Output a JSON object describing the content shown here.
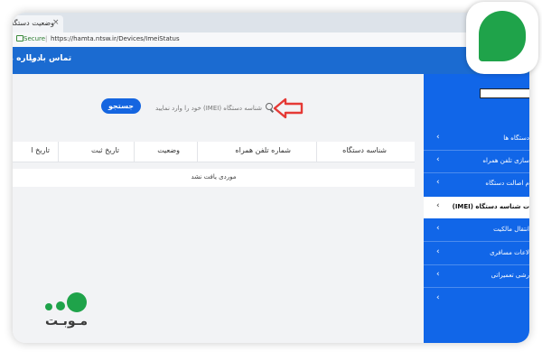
{
  "browser": {
    "tab_title": "وضعیت دستگاه",
    "tab_close": "×",
    "secure_label": "Secure",
    "separator": "|",
    "url": "https://hamta.ntsw.ir/Devices/ImeiStatus"
  },
  "navbar": {
    "contact": "تماس با ما",
    "about": "درباره ما"
  },
  "search": {
    "placeholder": "شناسه دستگاه (IMEI) خود را وارد نمایید",
    "button_label": "جستجو"
  },
  "table": {
    "columns": [
      "شناسه دستگاه",
      "شماره تلفن همراه",
      "وضعیت",
      "تاریخ ثبت",
      "تاریخ ا"
    ],
    "empty_message": "موردی یافت نشد"
  },
  "sidebar": {
    "items": [
      {
        "label": "دستگاه ها",
        "chevron": "›"
      },
      {
        "label": "سازی تلفن همراه",
        "chevron": "›"
      },
      {
        "label": "م اصالت دستگاه",
        "chevron": "›"
      },
      {
        "label": "ت شناسه دستگاه (IMEI)",
        "chevron": "›"
      },
      {
        "label": "انتقال مالکیت",
        "chevron": "›"
      },
      {
        "label": "لاعات مسافری",
        "chevron": "›"
      },
      {
        "label": "رشی تعمیراتی",
        "chevron": "›"
      },
      {
        "label": "",
        "chevron": "›"
      }
    ]
  },
  "colors": {
    "navbar": "#1b6bd1",
    "sidebar": "#1166e8",
    "button": "#1565e0",
    "badge_green": "#1fa34a",
    "arrow_red": "#e53935"
  },
  "watermark": {
    "text": "مـوبـت"
  }
}
